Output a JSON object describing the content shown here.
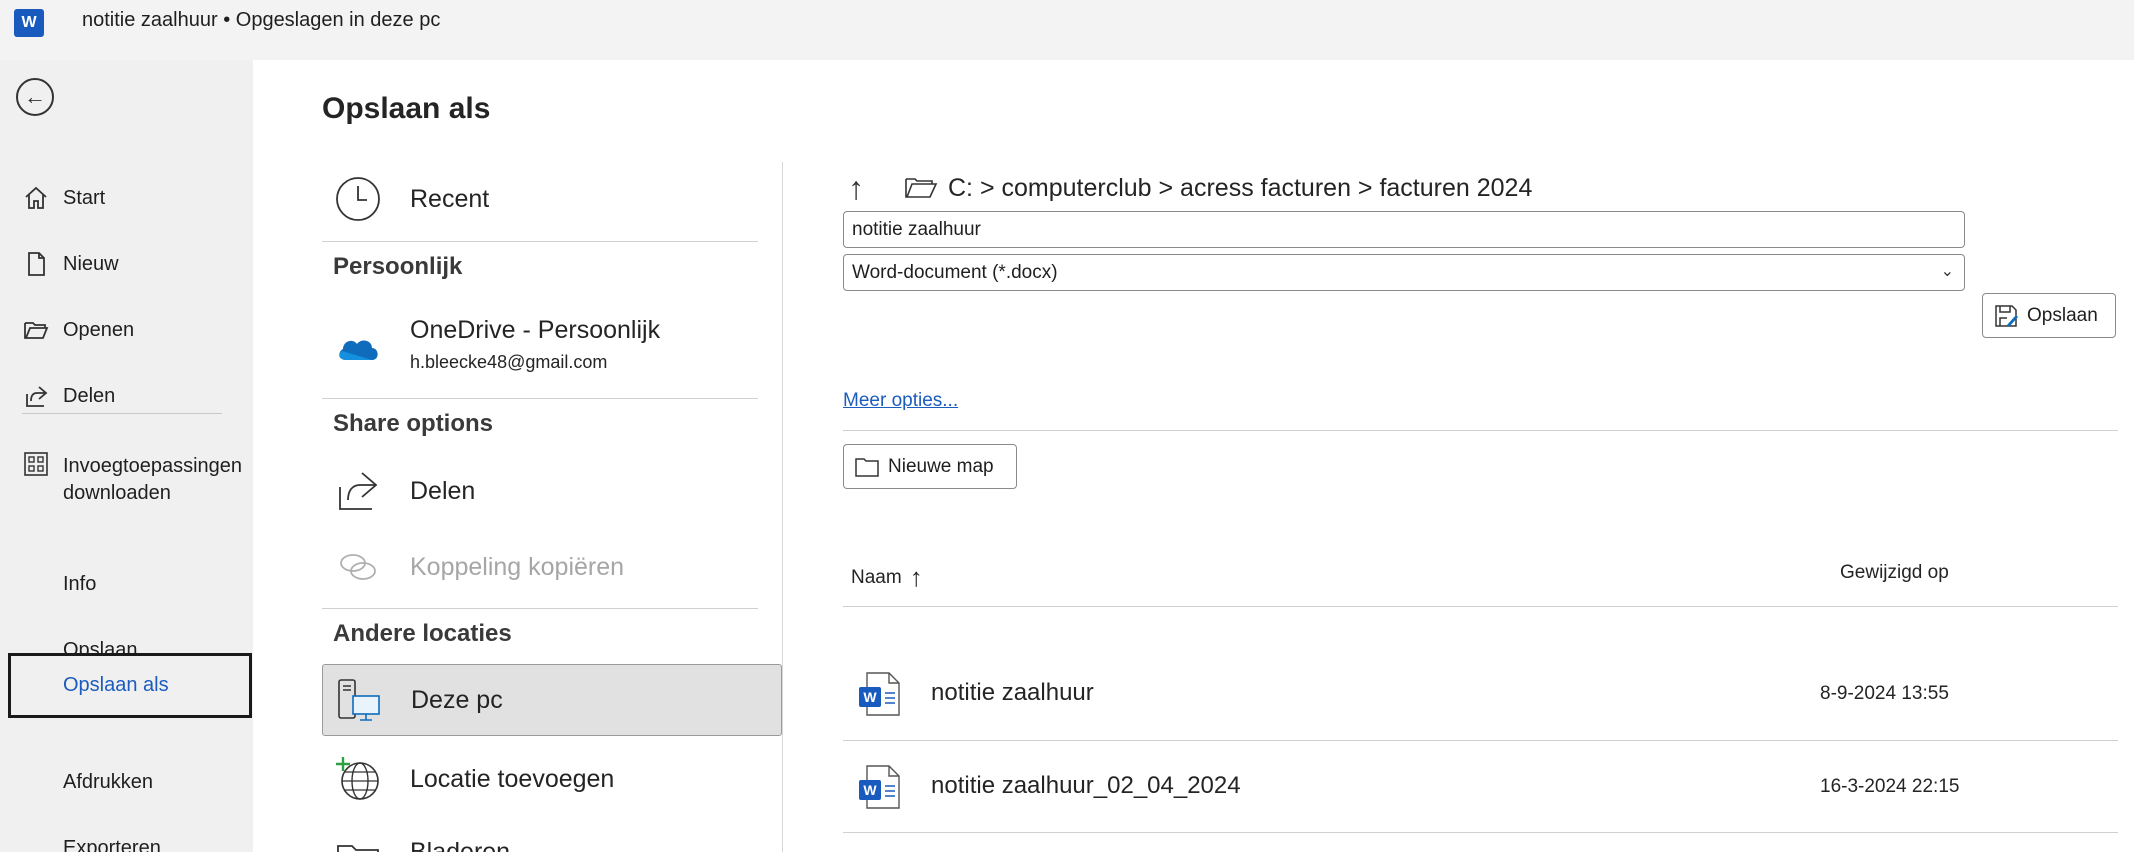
{
  "titlebar": {
    "app_icon": "word-logo",
    "title": "notitie zaalhuur • Opgeslagen in deze pc"
  },
  "nav": {
    "back_icon": "back-arrow-icon",
    "items": [
      {
        "label": "Start",
        "icon": "home-icon"
      },
      {
        "label": "Nieuw",
        "icon": "new-document-icon"
      },
      {
        "label": "Openen",
        "icon": "open-folder-icon"
      },
      {
        "label": "Delen",
        "icon": "share-icon"
      },
      {
        "label": "Invoegtoepassingen downloaden",
        "icon": "addins-grid-icon"
      },
      {
        "label": "Info"
      },
      {
        "label": "Opslaan"
      },
      {
        "label": "Opslaan als",
        "active": true
      },
      {
        "label": "Afdrukken"
      },
      {
        "label": "Exporteren"
      }
    ]
  },
  "page": {
    "title": "Opslaan als"
  },
  "locations": {
    "recent": {
      "label": "Recent",
      "icon": "clock-icon"
    },
    "personal_heading": "Persoonlijk",
    "onedrive": {
      "label": "OneDrive - Persoonlijk",
      "email": "h.bleecke48@gmail.com",
      "icon": "onedrive-cloud-icon"
    },
    "share_heading": "Share options",
    "share": {
      "label": "Delen",
      "icon": "share-icon"
    },
    "copy_link": {
      "label": "Koppeling kopiëren",
      "icon": "link-icon",
      "disabled": true
    },
    "other_heading": "Andere locaties",
    "this_pc": {
      "label": "Deze pc",
      "icon": "computer-icon",
      "selected": true
    },
    "add_location": {
      "label": "Locatie toevoegen",
      "icon": "globe-add-icon"
    },
    "browse": {
      "label": "Bladeren",
      "icon": "folder-icon"
    }
  },
  "save_panel": {
    "path": "C: > computerclub > acress facturen > facturen 2024",
    "filename": "notitie zaalhuur",
    "filetype": "Word-document (*.docx)",
    "save_button": "Opslaan",
    "more_options": "Meer opties...",
    "new_folder_button": "Nieuwe map"
  },
  "files": {
    "columns": {
      "name": "Naam",
      "sort_icon": "sort-up-arrow-icon",
      "modified": "Gewijzigd op"
    },
    "rows": [
      {
        "name": "notitie zaalhuur",
        "modified": "8-9-2024 13:55",
        "icon": "word-file-icon"
      },
      {
        "name": "notitie zaalhuur_02_04_2024",
        "modified": "16-3-2024 22:15",
        "icon": "word-file-icon"
      }
    ]
  },
  "colors": {
    "accent": "#1b5cbe",
    "nav_bg": "#f0f0f0",
    "selected_bg": "#e1e1e1"
  }
}
